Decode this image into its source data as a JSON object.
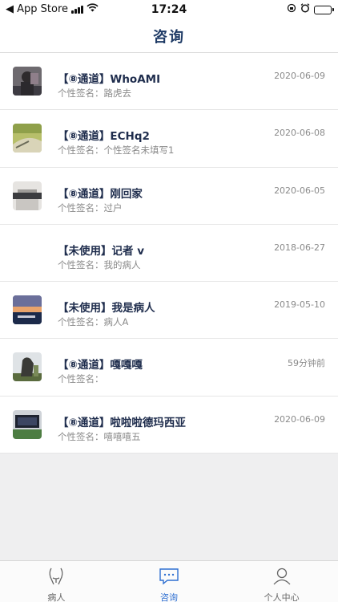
{
  "status_bar": {
    "back_label": "◀ App Store",
    "time": "17:24",
    "battery_color": "#3fc24d"
  },
  "nav": {
    "title": "咨询"
  },
  "list": [
    {
      "name": "【⑧通道】WhoAMI",
      "signature": "个性签名：路虎去",
      "date": "2020-06-09",
      "avatar": "avatar-person"
    },
    {
      "name": "【⑧通道】ECHq2",
      "signature": "个性签名：个性签名未填写1",
      "date": "2020-06-08",
      "avatar": "avatar-landscape"
    },
    {
      "name": "【⑧通道】刚回家",
      "signature": "个性签名：过户",
      "date": "2020-06-05",
      "avatar": "avatar-room"
    },
    {
      "name": "【未使用】记者 v",
      "signature": "个性签名：我的病人",
      "date": "2018-06-27",
      "avatar": ""
    },
    {
      "name": "【未使用】我是病人",
      "signature": "个性签名：病人A",
      "date": "2019-05-10",
      "avatar": "avatar-sunset"
    },
    {
      "name": "【⑧通道】嘎嘎嘎",
      "signature": "个性签名：",
      "date": "59分钟前",
      "avatar": "avatar-sculpture"
    },
    {
      "name": "【⑧通道】啦啦啦德玛西亚",
      "signature": "个性签名：嘻嘻嘻五",
      "date": "2020-06-09",
      "avatar": "avatar-screen"
    }
  ],
  "tabbar": {
    "active_color": "#2e6fd1",
    "tabs": [
      {
        "label": "病人",
        "icon": "patient-icon"
      },
      {
        "label": "咨询",
        "icon": "chat-icon"
      },
      {
        "label": "个人中心",
        "icon": "person-icon"
      }
    ]
  }
}
